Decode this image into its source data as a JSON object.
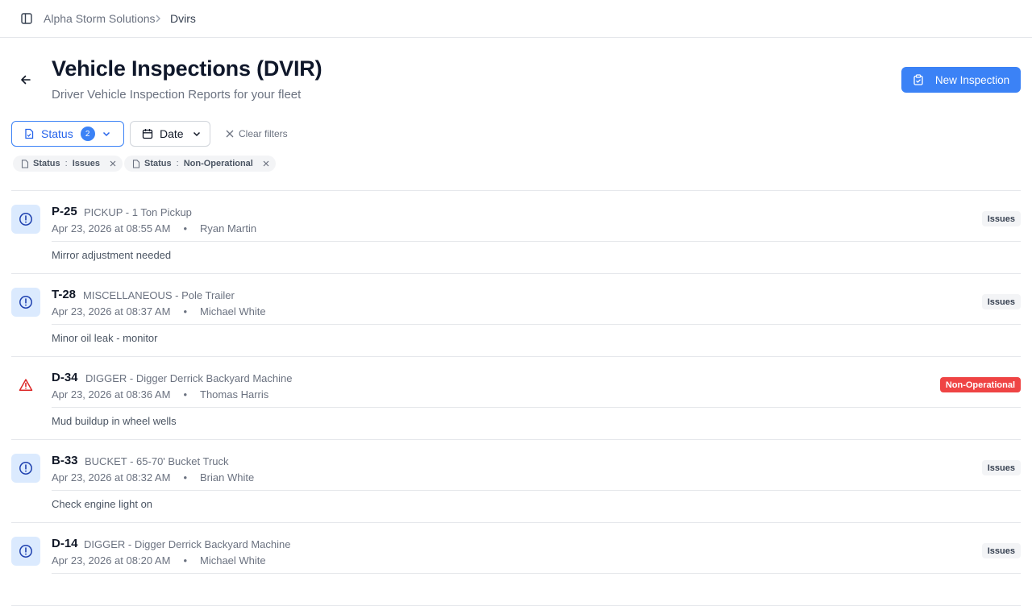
{
  "breadcrumb": {
    "org": "Alpha Storm Solutions",
    "current": "Dvirs"
  },
  "header": {
    "title": "Vehicle Inspections (DVIR)",
    "subtitle": "Driver Vehicle Inspection Reports for your fleet",
    "new_button": "New Inspection"
  },
  "filters": {
    "status_label": "Status",
    "status_count": "2",
    "date_label": "Date",
    "clear_label": "Clear filters",
    "chips": [
      {
        "field": "Status",
        "sep": ":",
        "value": "Issues"
      },
      {
        "field": "Status",
        "sep": ":",
        "value": "Non-Operational"
      }
    ]
  },
  "inspections": [
    {
      "unit": "P-25",
      "type": "PICKUP - 1 Ton Pickup",
      "date": "Apr 23, 2026 at 08:55 AM",
      "dot": "•",
      "driver": "Ryan Martin",
      "note": "Mirror adjustment needed",
      "status": "Issues",
      "icon": "alert-circle-icon"
    },
    {
      "unit": "T-28",
      "type": "MISCELLANEOUS - Pole Trailer",
      "date": "Apr 23, 2026 at 08:37 AM",
      "dot": "•",
      "driver": "Michael White",
      "note": "Minor oil leak - monitor",
      "status": "Issues",
      "icon": "alert-circle-icon"
    },
    {
      "unit": "D-34",
      "type": "DIGGER - Digger Derrick Backyard Machine",
      "date": "Apr 23, 2026 at 08:36 AM",
      "dot": "•",
      "driver": "Thomas Harris",
      "note": "Mud buildup in wheel wells",
      "status": "Non-Operational",
      "icon": "alert-triangle-icon"
    },
    {
      "unit": "B-33",
      "type": "BUCKET - 65-70' Bucket Truck",
      "date": "Apr 23, 2026 at 08:32 AM",
      "dot": "•",
      "driver": "Brian White",
      "note": "Check engine light on",
      "status": "Issues",
      "icon": "alert-circle-icon"
    },
    {
      "unit": "D-14",
      "type": "DIGGER - Digger Derrick Backyard Machine",
      "date": "Apr 23, 2026 at 08:20 AM",
      "dot": "•",
      "driver": "Michael White",
      "note": "",
      "status": "Issues",
      "icon": "alert-circle-icon"
    }
  ],
  "colors": {
    "accent": "#3b82f6",
    "danger": "#ef4444",
    "icon_bg": "#dbeafe"
  }
}
